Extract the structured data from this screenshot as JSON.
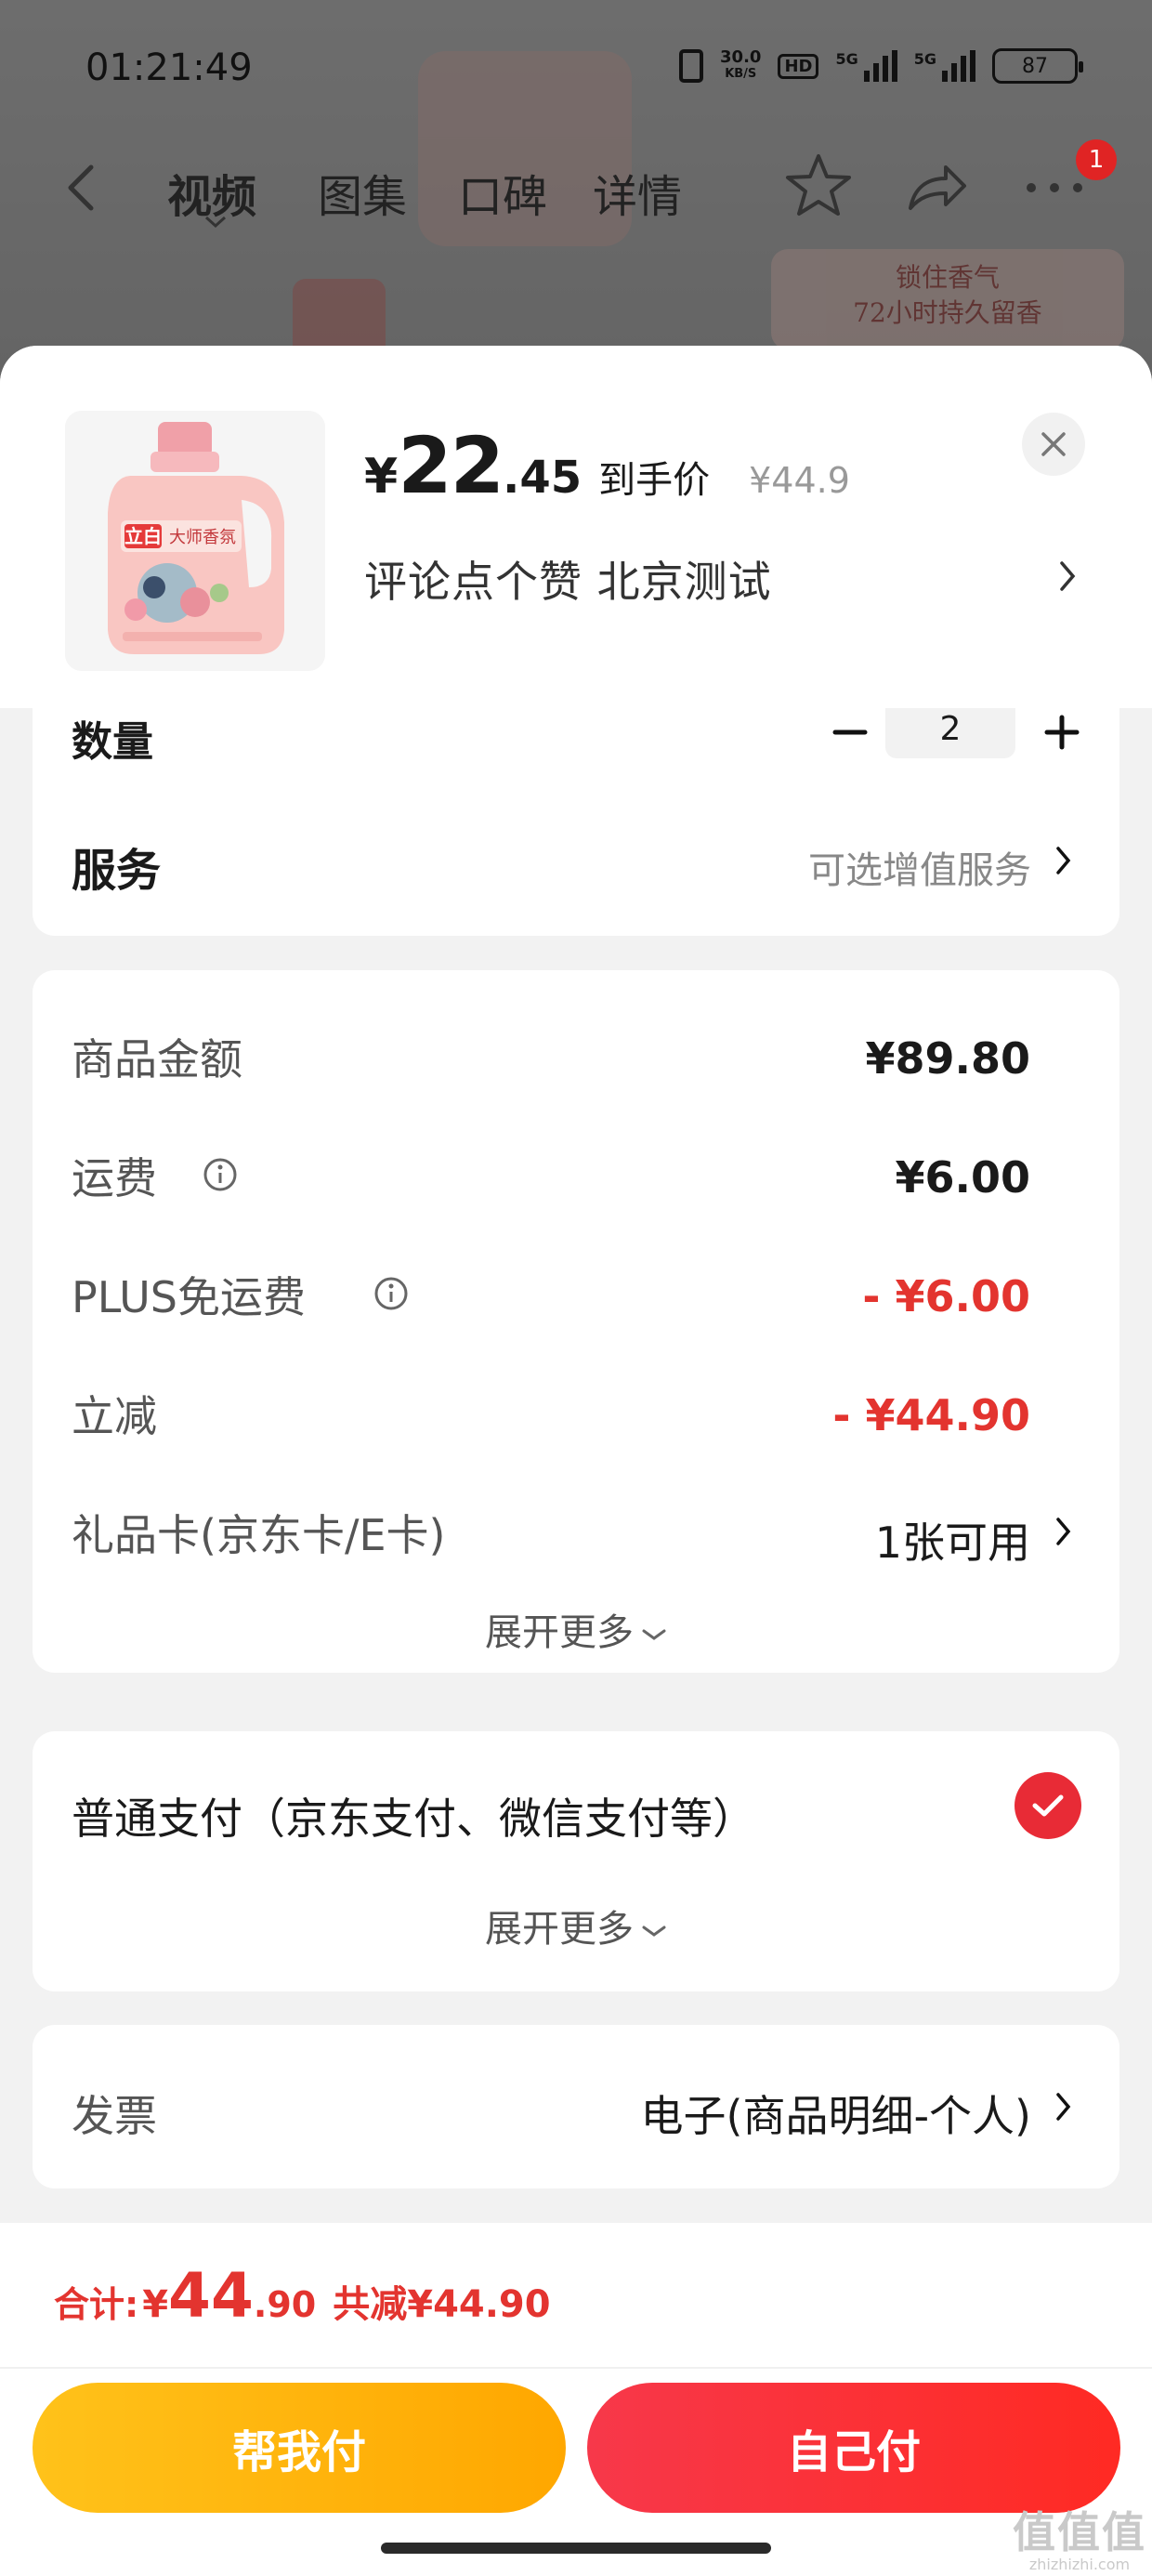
{
  "status_bar": {
    "time": "01:21:49",
    "net_speed": "30.0",
    "net_unit": "KB/S",
    "hd_label": "HD",
    "signal1_label": "5G",
    "signal2_label": "5G",
    "battery": "87"
  },
  "background": {
    "nav_tabs": [
      "视频",
      "图集",
      "口碑",
      "详情"
    ],
    "active_tab": "视频",
    "more_badge": "1",
    "banner_line1": "锁住香气",
    "banner_line2": "72小时持久留香"
  },
  "product": {
    "price_yen": "¥",
    "price_int": "22",
    "price_dec": ".45",
    "price_label": "到手价",
    "original_price": "¥44.9",
    "promo_text": "评论点个赞 北京测试",
    "bottle_brand": "立白",
    "bottle_name": "大师香氛"
  },
  "options": {
    "quantity_label": "数量",
    "quantity_value": "2",
    "service_label": "服务",
    "service_value": "可选增值服务"
  },
  "amounts": {
    "rows": [
      {
        "label": "商品金额",
        "value": "¥89.80",
        "info": false,
        "red": false
      },
      {
        "label": "运费",
        "value": "¥6.00",
        "info": true,
        "red": false
      },
      {
        "label": "PLUS免运费",
        "value": "- ¥6.00",
        "info": true,
        "red": true
      },
      {
        "label": "立减",
        "value": "- ¥44.90",
        "info": false,
        "red": true
      },
      {
        "label": "礼品卡(京东卡/E卡)",
        "value": "1张可用",
        "info": false,
        "red": false
      }
    ],
    "expand_label": "展开更多"
  },
  "payment": {
    "method_label": "普通支付（京东支付、微信支付等）",
    "expand_label": "展开更多"
  },
  "invoice": {
    "label": "发票",
    "value": "电子(商品明细-个人)"
  },
  "footer": {
    "total_label": "合计:",
    "total_yen": "¥",
    "total_int": "44",
    "total_dec": ".90",
    "total_saving": "共减¥44.90",
    "help_pay_label": "帮我付",
    "self_pay_label": "自己付"
  },
  "watermark": {
    "logo": "值值值",
    "site": "zhizhizhi.com"
  },
  "colors": {
    "accent_red": "#e3342f",
    "help_pay_yellow": "#ffb400",
    "self_pay_red": "#f7384a"
  }
}
